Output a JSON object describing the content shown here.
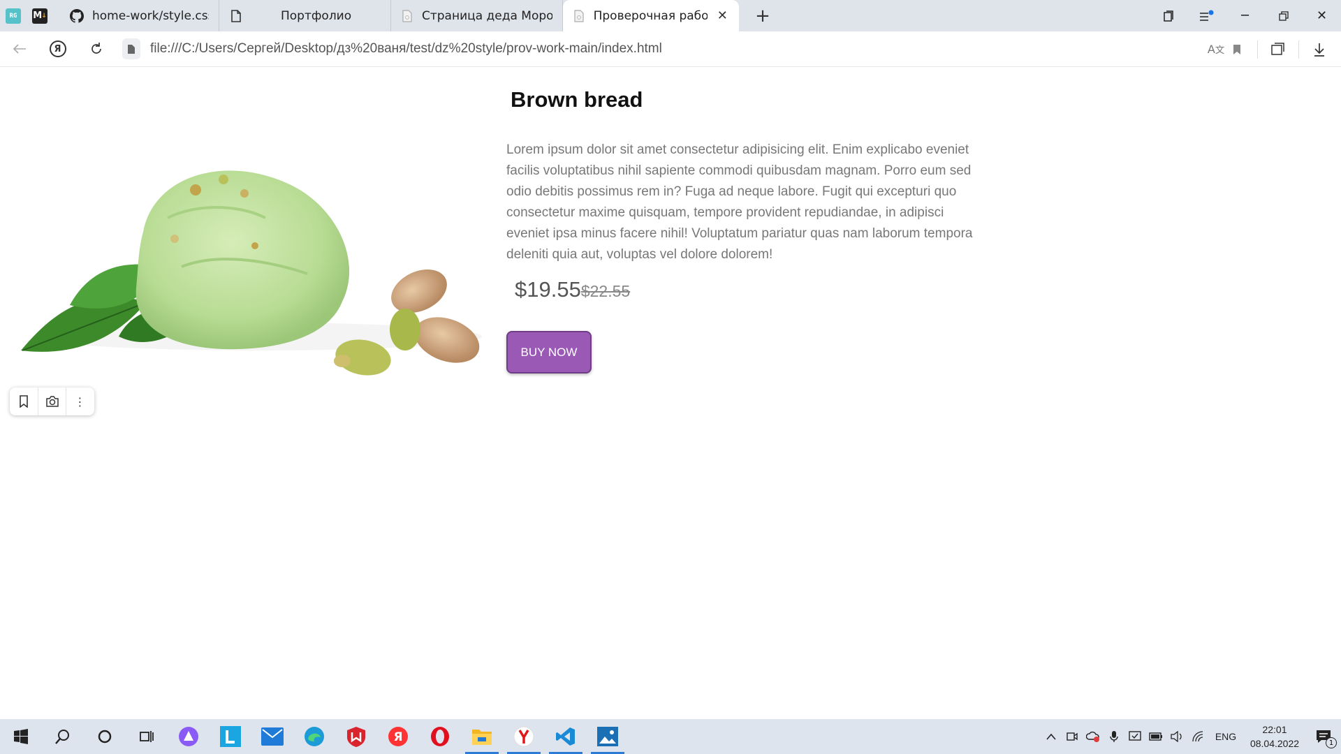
{
  "browser": {
    "tabs": [
      {
        "title": "home-work/style.css at ma",
        "icon": "github-icon",
        "active": false
      },
      {
        "title": "Портфолио",
        "icon": "document-icon",
        "active": false
      },
      {
        "title": "Страница деда Мороза",
        "icon": "page-icon",
        "active": false
      },
      {
        "title": "Проверочная работа",
        "icon": "page-icon",
        "active": true
      }
    ],
    "pinned": [
      {
        "label": "RG",
        "icon": "regex-icon"
      },
      {
        "label": "M",
        "icon": "markdown-icon"
      }
    ],
    "yandex_button": "Я",
    "url": "file:///C:/Users/Сергей/Desktop/дз%20ваня/test/dz%20style/prov-work-main/index.html"
  },
  "page": {
    "title": "Brown bread",
    "description": "Lorem ipsum dolor sit amet consectetur adipisicing elit. Enim explicabo eveniet facilis voluptatibus nihil sapiente commodi quibusdam magnam. Porro eum sed odio debitis possimus rem in? Fuga ad neque labore. Fugit qui excepturi quo consectetur maxime quisquam, tempore provident repudiandae, in adipisci eveniet ipsa minus facere nihil! Voluptatum pariatur quas nam laborum tempora deleniti quia aut, voluptas vel dolore dolorem!",
    "price_current": "$19.55",
    "price_old": "$22.55",
    "buy_label": "BUY NOW",
    "accent": "#9b59b6"
  },
  "taskbar": {
    "apps": [
      "windows-start-icon",
      "search-icon",
      "cortana-icon",
      "task-view-icon",
      "alice-icon",
      "lingvo-icon",
      "mail-icon",
      "edge-icon",
      "mcafee-icon",
      "yandex-music-icon",
      "opera-icon",
      "file-explorer-icon",
      "yandex-browser-icon",
      "vscode-icon",
      "photos-icon"
    ],
    "language": "ENG",
    "time": "22:01",
    "date": "08.04.2022",
    "notification_count": "1"
  }
}
